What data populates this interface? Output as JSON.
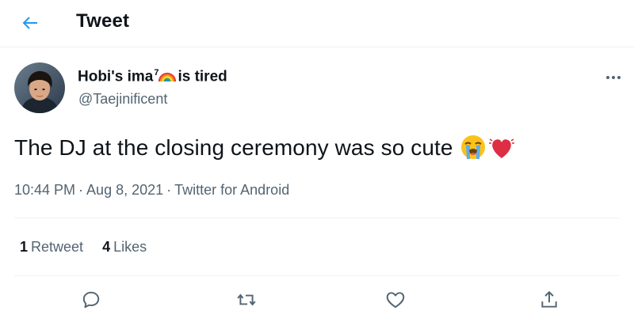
{
  "header": {
    "back_icon": "arrow-left-icon",
    "title": "Tweet"
  },
  "author": {
    "display_name_prefix": "Hobi's ima",
    "display_name_sup": "7",
    "display_name_emoji": "rainbow-emoji",
    "display_name_suffix": "is tired",
    "handle": "@Taejinificent"
  },
  "tweet": {
    "text": "The DJ at the closing ceremony was so cute",
    "emojis": [
      "loudly-crying-face-emoji",
      "beating-heart-emoji"
    ],
    "time": "10:44 PM",
    "date": "Aug 8, 2021",
    "separator": "·",
    "source": "Twitter for Android"
  },
  "stats": {
    "retweets_count": "1",
    "retweets_label": "Retweet",
    "likes_count": "4",
    "likes_label": "Likes"
  },
  "actions": [
    "reply-icon",
    "retweet-icon",
    "like-icon",
    "share-icon"
  ],
  "colors": {
    "accent": "#1d9bf0",
    "text_primary": "#0f1419",
    "text_secondary": "#536471",
    "divider": "#eff3f4"
  }
}
